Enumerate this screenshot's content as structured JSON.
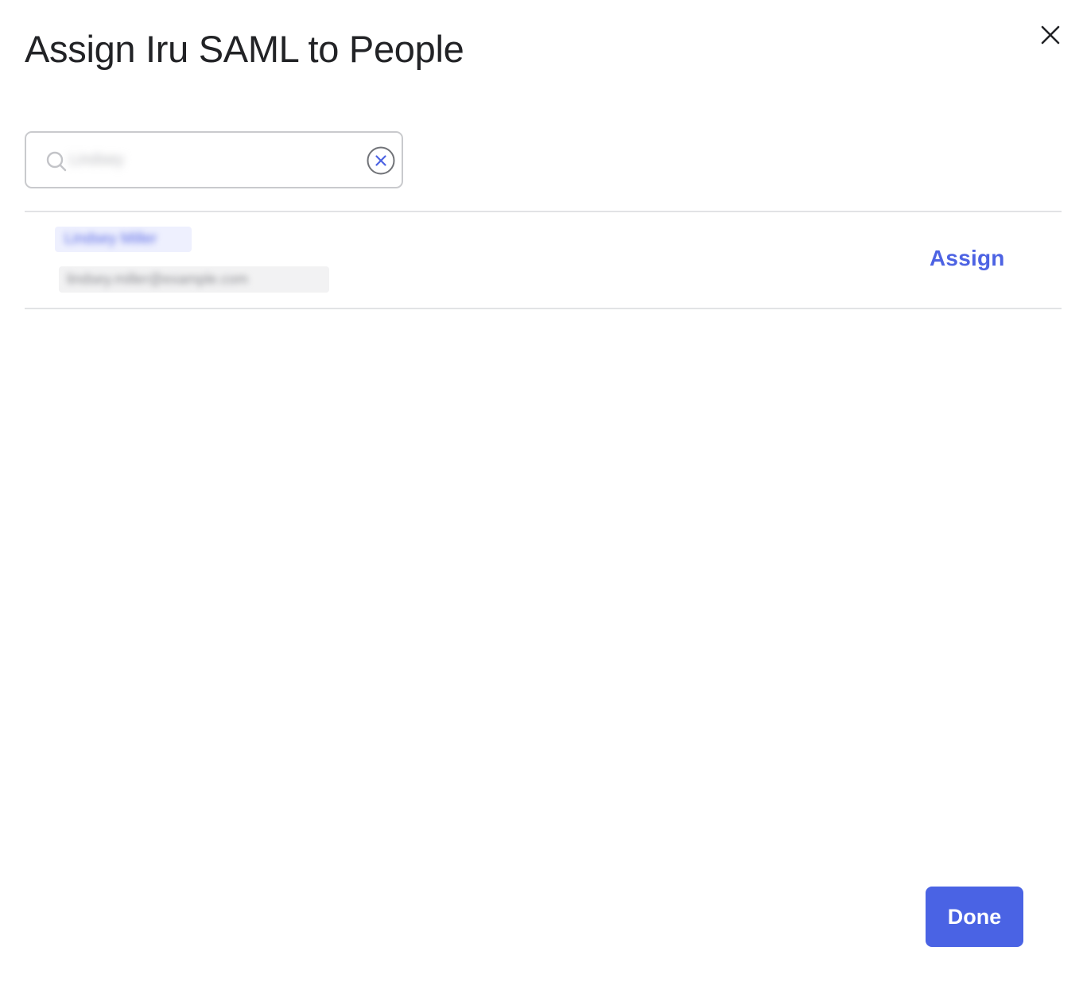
{
  "modal": {
    "title": "Assign Iru SAML to People",
    "close_icon": "close-icon"
  },
  "search": {
    "value": "Lindsey",
    "search_icon": "search-icon",
    "clear_icon": "clear-circle-x-icon"
  },
  "results": [
    {
      "name": "Lindsey Miller",
      "email": "lindsey.miller@example.com",
      "action_label": "Assign"
    }
  ],
  "footer": {
    "done_label": "Done"
  },
  "colors": {
    "accent": "#4a63e4",
    "link": "#4d63e3",
    "title": "#222326",
    "divider": "#e2e3e5",
    "input_border": "#c9cacd"
  }
}
